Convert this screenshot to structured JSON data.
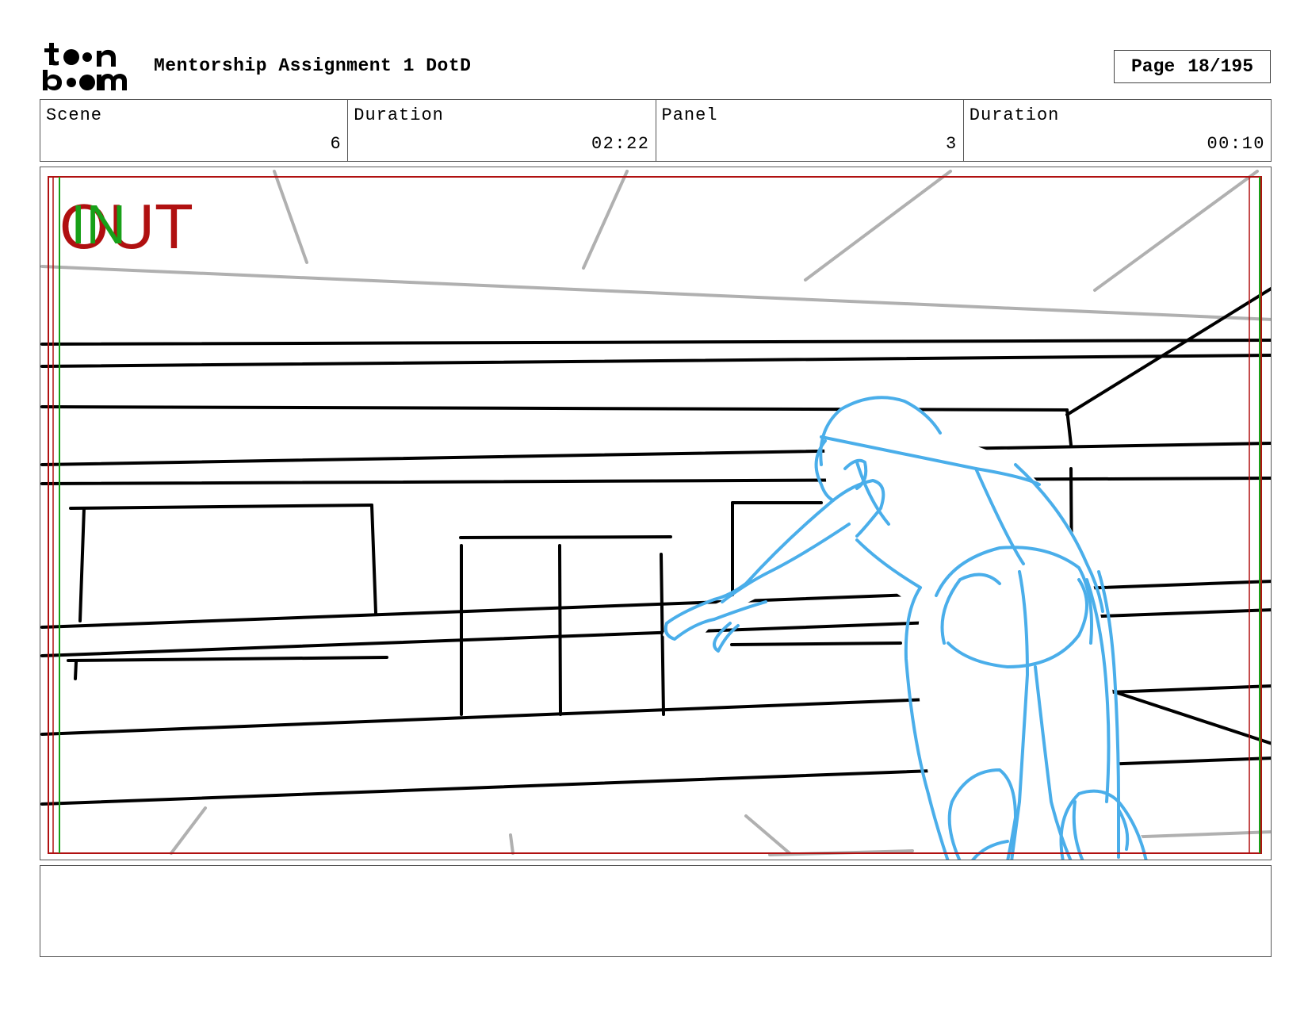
{
  "header": {
    "logo_text_top": "toon",
    "logo_text_bottom": "boom",
    "title": "Mentorship Assignment 1 DotD",
    "page_label": "Page",
    "page_value": "18/195"
  },
  "info": {
    "scene_label": "Scene",
    "scene_value": "6",
    "scene_duration_label": "Duration",
    "scene_duration_value": "02:22",
    "panel_label": "Panel",
    "panel_value": "3",
    "panel_duration_label": "Duration",
    "panel_duration_value": "00:10"
  },
  "panel": {
    "in_marker": "IN",
    "out_marker": "OUT"
  },
  "colors": {
    "figure_blue": "#4aaeea",
    "out_red": "#b01010",
    "in_green": "#18a018",
    "guide_gray": "#b0b0b0"
  },
  "notes": {
    "text": ""
  }
}
